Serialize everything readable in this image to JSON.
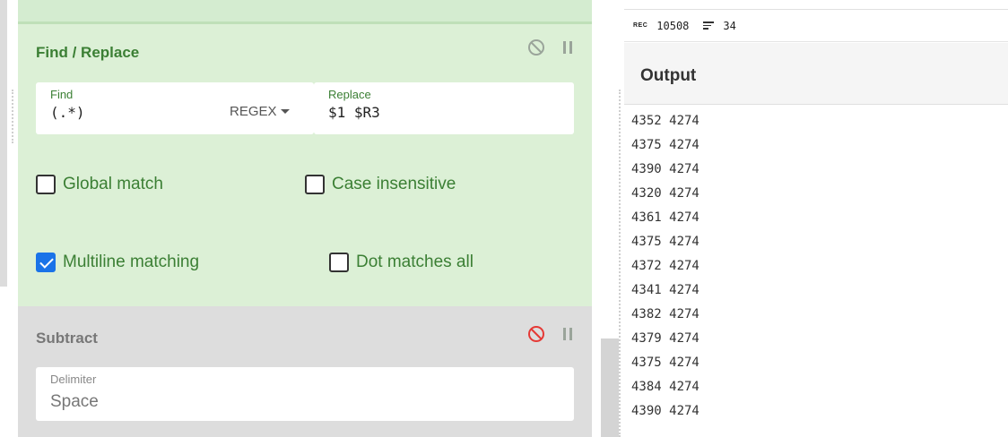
{
  "operations": {
    "find_replace": {
      "title": "Find / Replace",
      "find_label": "Find",
      "find_value": "(.*)",
      "find_mode": "REGEX",
      "replace_label": "Replace",
      "replace_value": "$1 $R3",
      "options": [
        {
          "label": "Global match",
          "checked": false
        },
        {
          "label": "Case insensitive",
          "checked": false
        },
        {
          "label": "Multiline matching",
          "checked": true
        },
        {
          "label": "Dot matches all",
          "checked": false
        }
      ]
    },
    "subtract": {
      "title": "Subtract",
      "delimiter_label": "Delimiter",
      "delimiter_value": "Space",
      "disabled_color": "#e53935"
    }
  },
  "output": {
    "title": "Output",
    "stats": {
      "length": "10508",
      "lines": "34"
    },
    "lines": [
      "4352 4274",
      "4375 4274",
      "4390 4274",
      "4320 4274",
      "4361 4274",
      "4375 4274",
      "4372 4274",
      "4341 4274",
      "4382 4274",
      "4379 4274",
      "4375 4274",
      "4384 4274",
      "4390 4274"
    ]
  },
  "colors": {
    "accent_green": "#3b7f34",
    "op_bg": "#dcf0d6",
    "checkbox_blue": "#1a73e8"
  }
}
